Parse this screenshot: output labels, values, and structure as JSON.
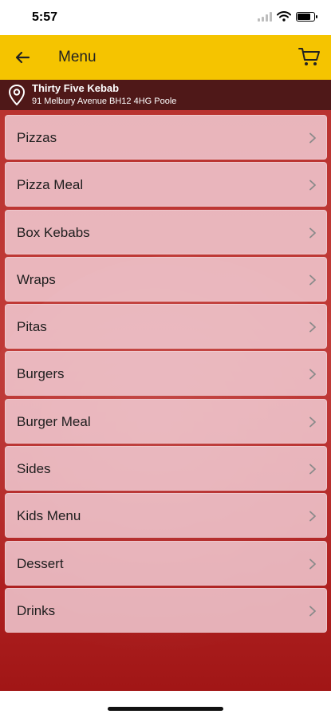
{
  "status": {
    "time": "5:57",
    "battery_level": 0.85
  },
  "app_bar": {
    "title": "Menu",
    "back_icon": "back-arrow-icon",
    "cart_icon": "cart-icon"
  },
  "store": {
    "name": "Thirty Five Kebab",
    "address": "91 Melbury Avenue BH12 4HG Poole"
  },
  "menu": {
    "items": [
      {
        "label": "Pizzas"
      },
      {
        "label": "Pizza Meal"
      },
      {
        "label": "Box Kebabs"
      },
      {
        "label": "Wraps"
      },
      {
        "label": "Pitas"
      },
      {
        "label": "Burgers"
      },
      {
        "label": "Burger Meal"
      },
      {
        "label": "Sides"
      },
      {
        "label": "Kids Menu"
      },
      {
        "label": "Dessert"
      },
      {
        "label": "Drinks"
      }
    ]
  },
  "colors": {
    "app_bar": "#f5c400",
    "background_red": "#b8322f",
    "item_fill": "#f3d2da"
  }
}
